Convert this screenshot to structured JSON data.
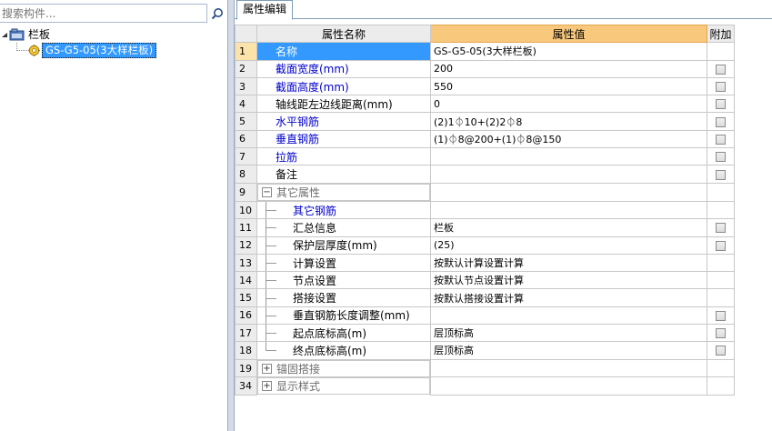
{
  "search": {
    "placeholder": "搜索构件...",
    "value": "搜索构件..."
  },
  "tree": {
    "parent_label": "栏板",
    "child_label": "GS-G5-05(3大样栏板)"
  },
  "tab": {
    "label": "属性编辑"
  },
  "grid": {
    "header": {
      "name": "属性名称",
      "value": "属性值",
      "extra": "附加"
    },
    "rows": [
      {
        "idx": "1",
        "name": "名称",
        "value": "GS-G5-05(3大样栏板)",
        "color": "blue",
        "checkbox": false,
        "selected": true
      },
      {
        "idx": "2",
        "name": "截面宽度(mm)",
        "value": "200",
        "color": "blue",
        "checkbox": true
      },
      {
        "idx": "3",
        "name": "截面高度(mm)",
        "value": "550",
        "color": "blue",
        "checkbox": true
      },
      {
        "idx": "4",
        "name": "轴线距左边线距离(mm)",
        "value": "0",
        "color": "black",
        "checkbox": true
      },
      {
        "idx": "5",
        "name": "水平钢筋",
        "value": "(2)1⏀10+(2)2⏀8",
        "color": "blue",
        "checkbox": true
      },
      {
        "idx": "6",
        "name": "垂直钢筋",
        "value": "(1)⏀8@200+(1)⏀8@150",
        "color": "blue",
        "checkbox": true
      },
      {
        "idx": "7",
        "name": "拉筋",
        "value": "",
        "color": "blue",
        "checkbox": true
      },
      {
        "idx": "8",
        "name": "备注",
        "value": "",
        "color": "black",
        "checkbox": true
      },
      {
        "idx": "9",
        "name": "其它属性",
        "value": "",
        "color": "gray",
        "checkbox": false,
        "group": "expanded"
      },
      {
        "idx": "10",
        "name": "其它钢筋",
        "value": "",
        "color": "blue",
        "checkbox": false,
        "child": true
      },
      {
        "idx": "11",
        "name": "汇总信息",
        "value": "栏板",
        "color": "black",
        "checkbox": true,
        "child": true
      },
      {
        "idx": "12",
        "name": "保护层厚度(mm)",
        "value": "(25)",
        "color": "black",
        "checkbox": true,
        "child": true
      },
      {
        "idx": "13",
        "name": "计算设置",
        "value": "按默认计算设置计算",
        "color": "black",
        "checkbox": false,
        "child": true
      },
      {
        "idx": "14",
        "name": "节点设置",
        "value": "按默认节点设置计算",
        "color": "black",
        "checkbox": false,
        "child": true
      },
      {
        "idx": "15",
        "name": "搭接设置",
        "value": "按默认搭接设置计算",
        "color": "black",
        "checkbox": false,
        "child": true
      },
      {
        "idx": "16",
        "name": "垂直钢筋长度调整(mm)",
        "value": "",
        "color": "black",
        "checkbox": true,
        "child": true
      },
      {
        "idx": "17",
        "name": "起点底标高(m)",
        "value": "层顶标高",
        "color": "black",
        "checkbox": true,
        "child": true
      },
      {
        "idx": "18",
        "name": "终点底标高(m)",
        "value": "层顶标高",
        "color": "black",
        "checkbox": true,
        "child": true,
        "last": true
      },
      {
        "idx": "19",
        "name": "锚固搭接",
        "value": "",
        "color": "gray",
        "checkbox": false,
        "group": "collapsed"
      },
      {
        "idx": "34",
        "name": "显示样式",
        "value": "",
        "color": "gray",
        "checkbox": false,
        "group": "collapsed"
      }
    ]
  },
  "icons": {
    "search": "search-icon",
    "parent_node": "railing-folder-icon",
    "child_node": "component-gear-icon"
  },
  "colors": {
    "selection": "#3399ff",
    "header_value_bg": "#f8c87c",
    "blue_text": "#0000cc",
    "gray_text": "#6e6e6e"
  }
}
